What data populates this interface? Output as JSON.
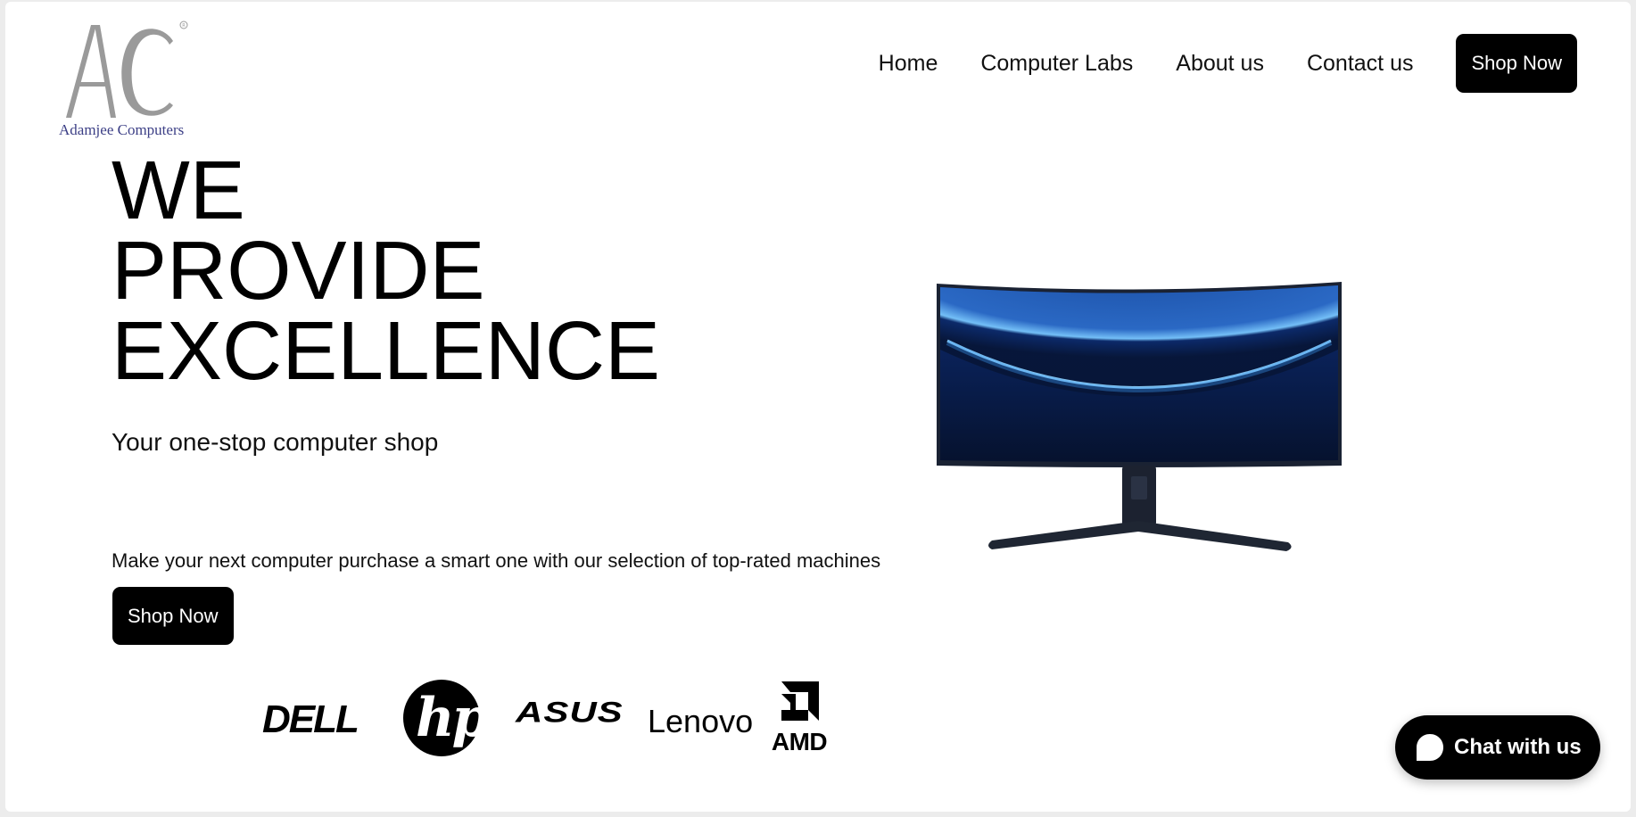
{
  "brand": {
    "logo_caption": "Adamjee Computers"
  },
  "nav": {
    "items": [
      {
        "label": "Home"
      },
      {
        "label": "Computer Labs"
      },
      {
        "label": "About us"
      },
      {
        "label": "Contact us"
      }
    ],
    "shop_label": "Shop Now"
  },
  "hero": {
    "title_lines": [
      "WE",
      "PROVIDE",
      "EXCELLENCE"
    ],
    "subtitle": "Your one-stop computer shop",
    "description": "Make your next computer purchase a smart one with our selection of top-rated machines",
    "cta_label": "Shop Now"
  },
  "partners": {
    "logos": [
      "DELL",
      "hp",
      "ASUS",
      "Lenovo",
      "AMD"
    ]
  },
  "chat": {
    "label": "Chat with us"
  },
  "colors": {
    "primary": "#000000",
    "text": "#111111",
    "logo_gray": "#9a9a9a",
    "logo_caption": "#3c3f86",
    "monitor_screen": "#0b2a6b",
    "monitor_glow": "#5fb6ff"
  }
}
